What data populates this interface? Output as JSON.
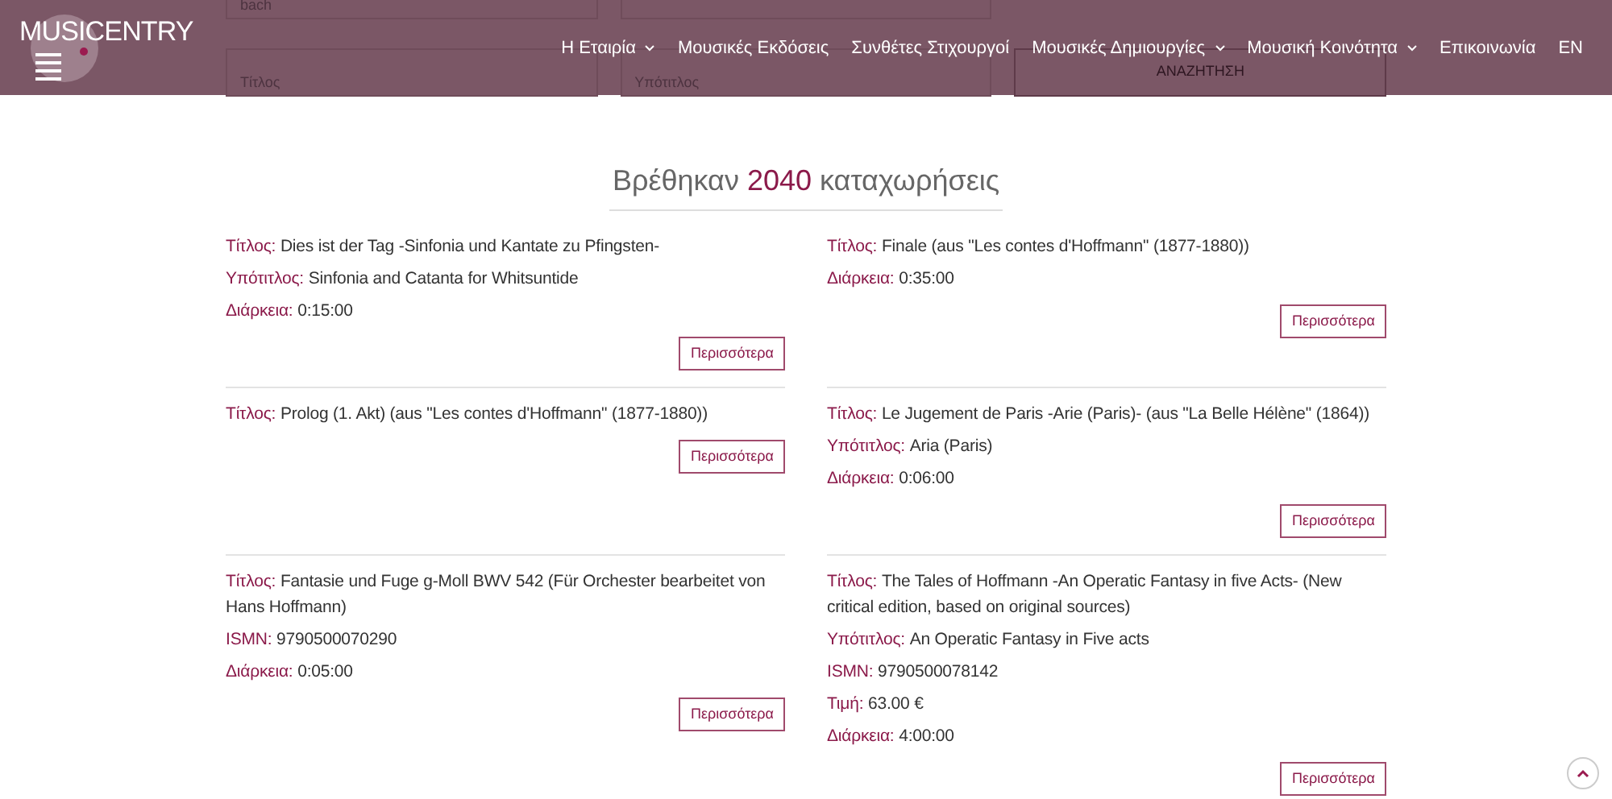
{
  "header": {
    "logo": "MUSICENTRY",
    "nav": [
      {
        "label": "Η Εταιρία",
        "dropdown": true
      },
      {
        "label": "Μουσικές Εκδόσεις",
        "dropdown": false
      },
      {
        "label": "Συνθέτες Στιχουργοί",
        "dropdown": false
      },
      {
        "label": "Μουσικές Δημιουργίες",
        "dropdown": true
      },
      {
        "label": "Μουσική Κοινότητα",
        "dropdown": true
      },
      {
        "label": "Επικοινωνία",
        "dropdown": false
      },
      {
        "label": "EN",
        "dropdown": false
      }
    ]
  },
  "search": {
    "fields": [
      {
        "value": "bach"
      },
      {
        "placeholder": "Τίτλος"
      },
      {
        "placeholder": "Υπότιτλος"
      }
    ],
    "button": "ΑΝΑΖΗΤΗΣΗ"
  },
  "results": {
    "prefix": "Βρέθηκαν",
    "count": "2040",
    "suffix": "καταχωρήσεις"
  },
  "entries": [
    {
      "fields": [
        {
          "label": "Τίτλος:",
          "value": "Dies ist der Tag -Sinfonia und Kantate zu Pfingsten-"
        },
        {
          "label": "Υπότιτλος:",
          "value": "Sinfonia and Catanta for Whitsuntide"
        },
        {
          "label": "Διάρκεια:",
          "value": "0:15:00"
        }
      ],
      "button": "Περισσότερα"
    },
    {
      "fields": [
        {
          "label": "Τίτλος:",
          "value": "Finale (aus \"Les contes d'Hoffmann\" (1877-1880))"
        },
        {
          "label": "Διάρκεια:",
          "value": "0:35:00"
        }
      ],
      "button": "Περισσότερα"
    },
    {
      "fields": [
        {
          "label": "Τίτλος:",
          "value": "Prolog (1. Akt) (aus \"Les contes d'Hoffmann\" (1877-1880))"
        }
      ],
      "button": "Περισσότερα"
    },
    {
      "fields": [
        {
          "label": "Τίτλος:",
          "value": "Le Jugement de Paris -Arie (Paris)- (aus \"La Belle Hélène\" (1864))"
        },
        {
          "label": "Υπότιτλος:",
          "value": "Aria (Paris)"
        },
        {
          "label": "Διάρκεια:",
          "value": "0:06:00"
        }
      ],
      "button": "Περισσότερα"
    },
    {
      "fields": [
        {
          "label": "Τίτλος:",
          "value": "Fantasie und Fuge g-Moll BWV 542 (Für Orchester bearbeitet von Hans Hoffmann)"
        },
        {
          "label": "ISMN:",
          "value": "9790500070290"
        },
        {
          "label": "Διάρκεια:",
          "value": "0:05:00"
        }
      ],
      "button": "Περισσότερα"
    },
    {
      "fields": [
        {
          "label": "Τίτλος:",
          "value": "The Tales of Hoffmann -An Operatic Fantasy in five Acts- (New critical edition, based on original sources)"
        },
        {
          "label": "Υπότιτλος:",
          "value": "An Operatic Fantasy in Five acts"
        },
        {
          "label": "ISMN:",
          "value": "9790500078142"
        },
        {
          "label": "Τιμή:",
          "value": "63.00 €"
        },
        {
          "label": "Διάρκεια:",
          "value": "4:00:00"
        }
      ],
      "button": "Περισσότερα"
    }
  ]
}
